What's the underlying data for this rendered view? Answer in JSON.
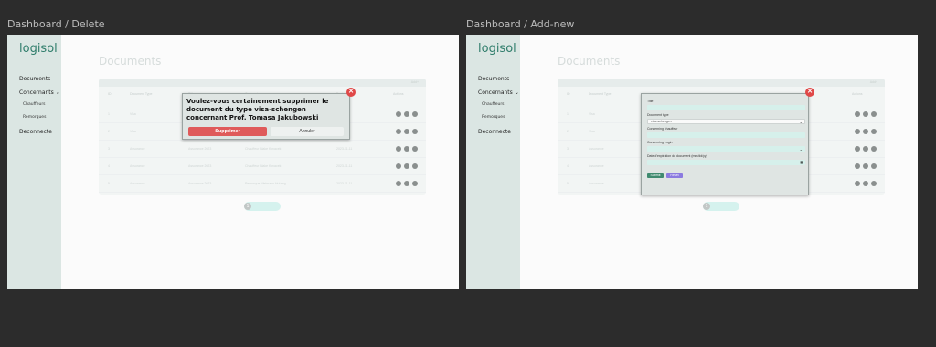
{
  "frames": [
    {
      "label": "Dashboard / Delete",
      "modal_type": "delete",
      "confirm_text": "Voulez-vous certainement supprimer le document du type visa-schengen concernant Prof. Tomasa Jakubowski",
      "delete_label": "Supprimer",
      "cancel_label": "Annuler"
    },
    {
      "label": "Dashboard / Add-new",
      "modal_type": "add",
      "fields": [
        {
          "label": "Title",
          "kind": "text",
          "value": ""
        },
        {
          "label": "Document type",
          "kind": "select",
          "value": "visa-schengen"
        },
        {
          "label": "Concerning chauffeur",
          "kind": "text",
          "value": ""
        },
        {
          "label": "Concerning engin",
          "kind": "select",
          "value": ""
        },
        {
          "label": "Date d'expiration du document (mm/dd/yy)",
          "kind": "date",
          "value": ""
        }
      ],
      "submit_label": "Submit",
      "reset_label": "Reset"
    }
  ],
  "sidebar": {
    "logo": "logisol",
    "items": [
      {
        "label": "Documents"
      },
      {
        "label": "Concernants"
      },
      {
        "label": "Chauffeurs"
      },
      {
        "label": "Remorques"
      },
      {
        "label": "Deconnecte"
      }
    ]
  },
  "main": {
    "title": "Documents",
    "add_button": "Add+",
    "headers": [
      "ID",
      "Document Type",
      "Title",
      "Concerning",
      "Expire",
      "Actions"
    ],
    "rows": [
      [
        "1",
        "Visa",
        "",
        "",
        ""
      ],
      [
        "2",
        "Visa",
        "",
        "",
        ""
      ],
      [
        "3",
        "Assurance",
        "Assurance 2023",
        "Chauffeur Blake Kovacek",
        "2023-11-11"
      ],
      [
        "4",
        "Assurance",
        "Assurance 2023",
        "Chauffeur Blake Kovacek",
        "2023-11-11"
      ],
      [
        "5",
        "Assurance",
        "Assurance 2023",
        "Remorque Weimann Huizing",
        "2023-11-11"
      ]
    ],
    "page": "1"
  },
  "colors": {
    "accent": "#2f7d6b",
    "danger": "#e04848"
  }
}
